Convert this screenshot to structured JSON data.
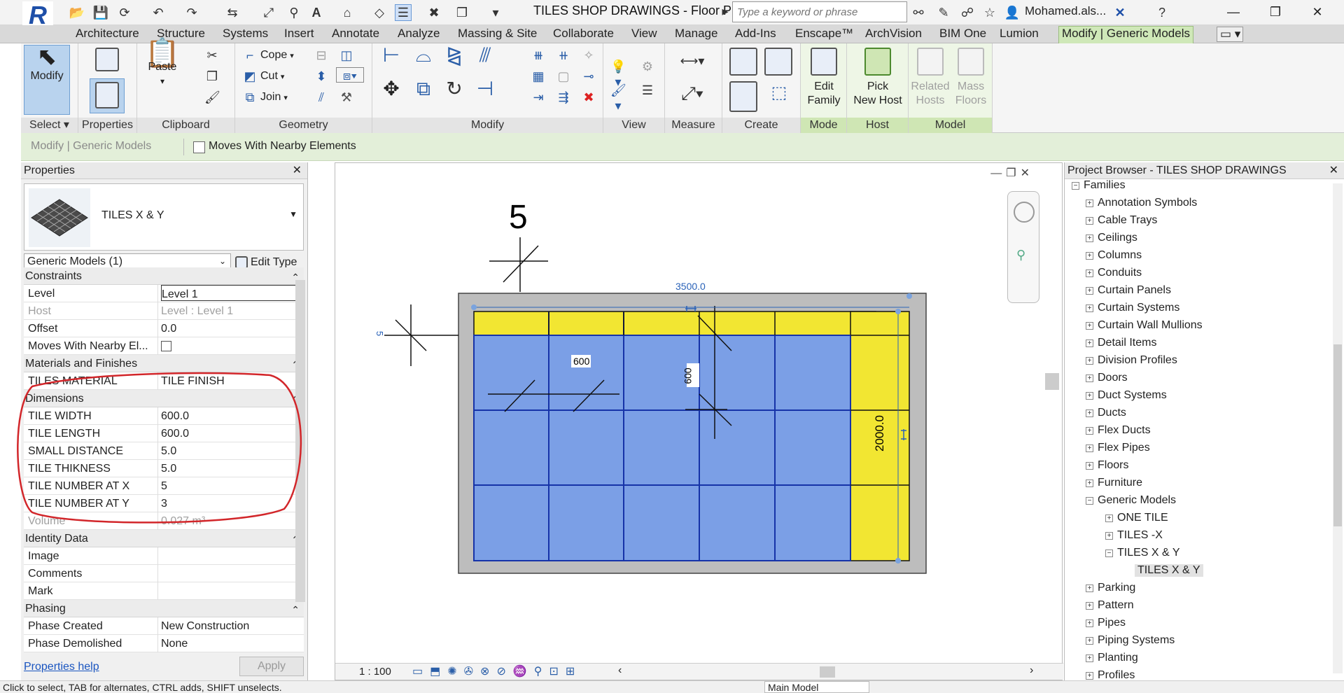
{
  "app": {
    "title": "TILES SHOP DRAWINGS - Floor Pla...",
    "search_placeholder": "Type a keyword or phrase",
    "user": "Mohamed.als...",
    "logo_letter": "R"
  },
  "tabs": [
    "Architecture",
    "Structure",
    "Systems",
    "Insert",
    "Annotate",
    "Analyze",
    "Massing & Site",
    "Collaborate",
    "View",
    "Manage",
    "Add-Ins",
    "Enscape™",
    "ArchVision",
    "BIM One",
    "Lumion",
    "Modify | Generic Models"
  ],
  "ribbon": {
    "modify_label": "Modify",
    "select_label": "Select ▾",
    "properties_label": "Properties",
    "paste_label": "Paste",
    "clipboard_label": "Clipboard",
    "cope_label": "Cope",
    "cut_label": "Cut",
    "join_label": "Join",
    "geometry_label": "Geometry",
    "modify_panel_label": "Modify",
    "view_label": "View",
    "measure_label": "Measure",
    "create_label": "Create",
    "edit_family_label": "Edit Family",
    "edit_label": "Edit",
    "family_label": "Family",
    "pick_label": "Pick",
    "new_host_label": "New Host",
    "related_label": "Related",
    "hosts_label": "Hosts",
    "mass_label": "Mass",
    "floors_label": "Floors",
    "mode_label": "Mode",
    "host_label": "Host",
    "model_label": "Model"
  },
  "options_bar": {
    "context": "Modify | Generic Models",
    "moves_with_nearby": "Moves With Nearby Elements"
  },
  "properties": {
    "title": "Properties",
    "type_name": "TILES X & Y",
    "instance_filter": "Generic Models (1)",
    "edit_type": "Edit Type",
    "help_link": "Properties help",
    "apply": "Apply",
    "groups": [
      {
        "name": "Constraints",
        "rows": [
          {
            "k": "Level",
            "v": "Level 1"
          },
          {
            "k": "Host",
            "v": "Level : Level 1",
            "dim": true
          },
          {
            "k": "Offset",
            "v": "0.0"
          },
          {
            "k": "Moves With Nearby El...",
            "v": ""
          }
        ]
      },
      {
        "name": "Materials and Finishes",
        "rows": [
          {
            "k": "TILES MATERIAL",
            "v": "TILE FINISH"
          }
        ]
      },
      {
        "name": "Dimensions",
        "rows": [
          {
            "k": "TILE WIDTH",
            "v": "600.0"
          },
          {
            "k": "TILE LENGTH",
            "v": "600.0"
          },
          {
            "k": "SMALL DISTANCE",
            "v": "5.0"
          },
          {
            "k": "TILE THIKNESS",
            "v": "5.0"
          },
          {
            "k": "TILE NUMBER AT X",
            "v": "5"
          },
          {
            "k": "TILE NUMBER AT Y",
            "v": "3"
          },
          {
            "k": "Volume",
            "v": "0.027 m³",
            "dim": true
          }
        ]
      },
      {
        "name": "Identity Data",
        "rows": [
          {
            "k": "Image",
            "v": ""
          },
          {
            "k": "Comments",
            "v": ""
          },
          {
            "k": "Mark",
            "v": ""
          }
        ]
      },
      {
        "name": "Phasing",
        "rows": [
          {
            "k": "Phase Created",
            "v": "New Construction"
          },
          {
            "k": "Phase Demolished",
            "v": "None"
          }
        ]
      }
    ]
  },
  "canvas": {
    "level_marker": "5",
    "side_marker": "5",
    "dim_top": "3500.0",
    "dim_tile_h": "600",
    "dim_tile_v": "600",
    "dim_right": "2000.0",
    "scale": "1 : 100",
    "colors": {
      "tile_blue": "#7b9fe6",
      "tile_yellow": "#f2e632",
      "border_gray": "#bdbdbd",
      "grid_line": "#1633a8"
    }
  },
  "browser": {
    "title": "Project Browser - TILES SHOP DRAWINGS",
    "root": "Families",
    "items": [
      "Annotation Symbols",
      "Cable Trays",
      "Ceilings",
      "Columns",
      "Conduits",
      "Curtain Panels",
      "Curtain Systems",
      "Curtain Wall Mullions",
      "Detail Items",
      "Division Profiles",
      "Doors",
      "Duct Systems",
      "Ducts",
      "Flex Ducts",
      "Flex Pipes",
      "Floors",
      "Furniture",
      "Generic Models"
    ],
    "generic_children": [
      "ONE TILE",
      "TILES -X",
      "TILES X & Y"
    ],
    "selected_type": "TILES X & Y",
    "items_after": [
      "Parking",
      "Pattern",
      "Pipes",
      "Piping Systems",
      "Planting",
      "Profiles"
    ]
  },
  "status": {
    "hint": "Click to select, TAB for alternates, CTRL adds, SHIFT unselects.",
    "model": "Main Model"
  }
}
